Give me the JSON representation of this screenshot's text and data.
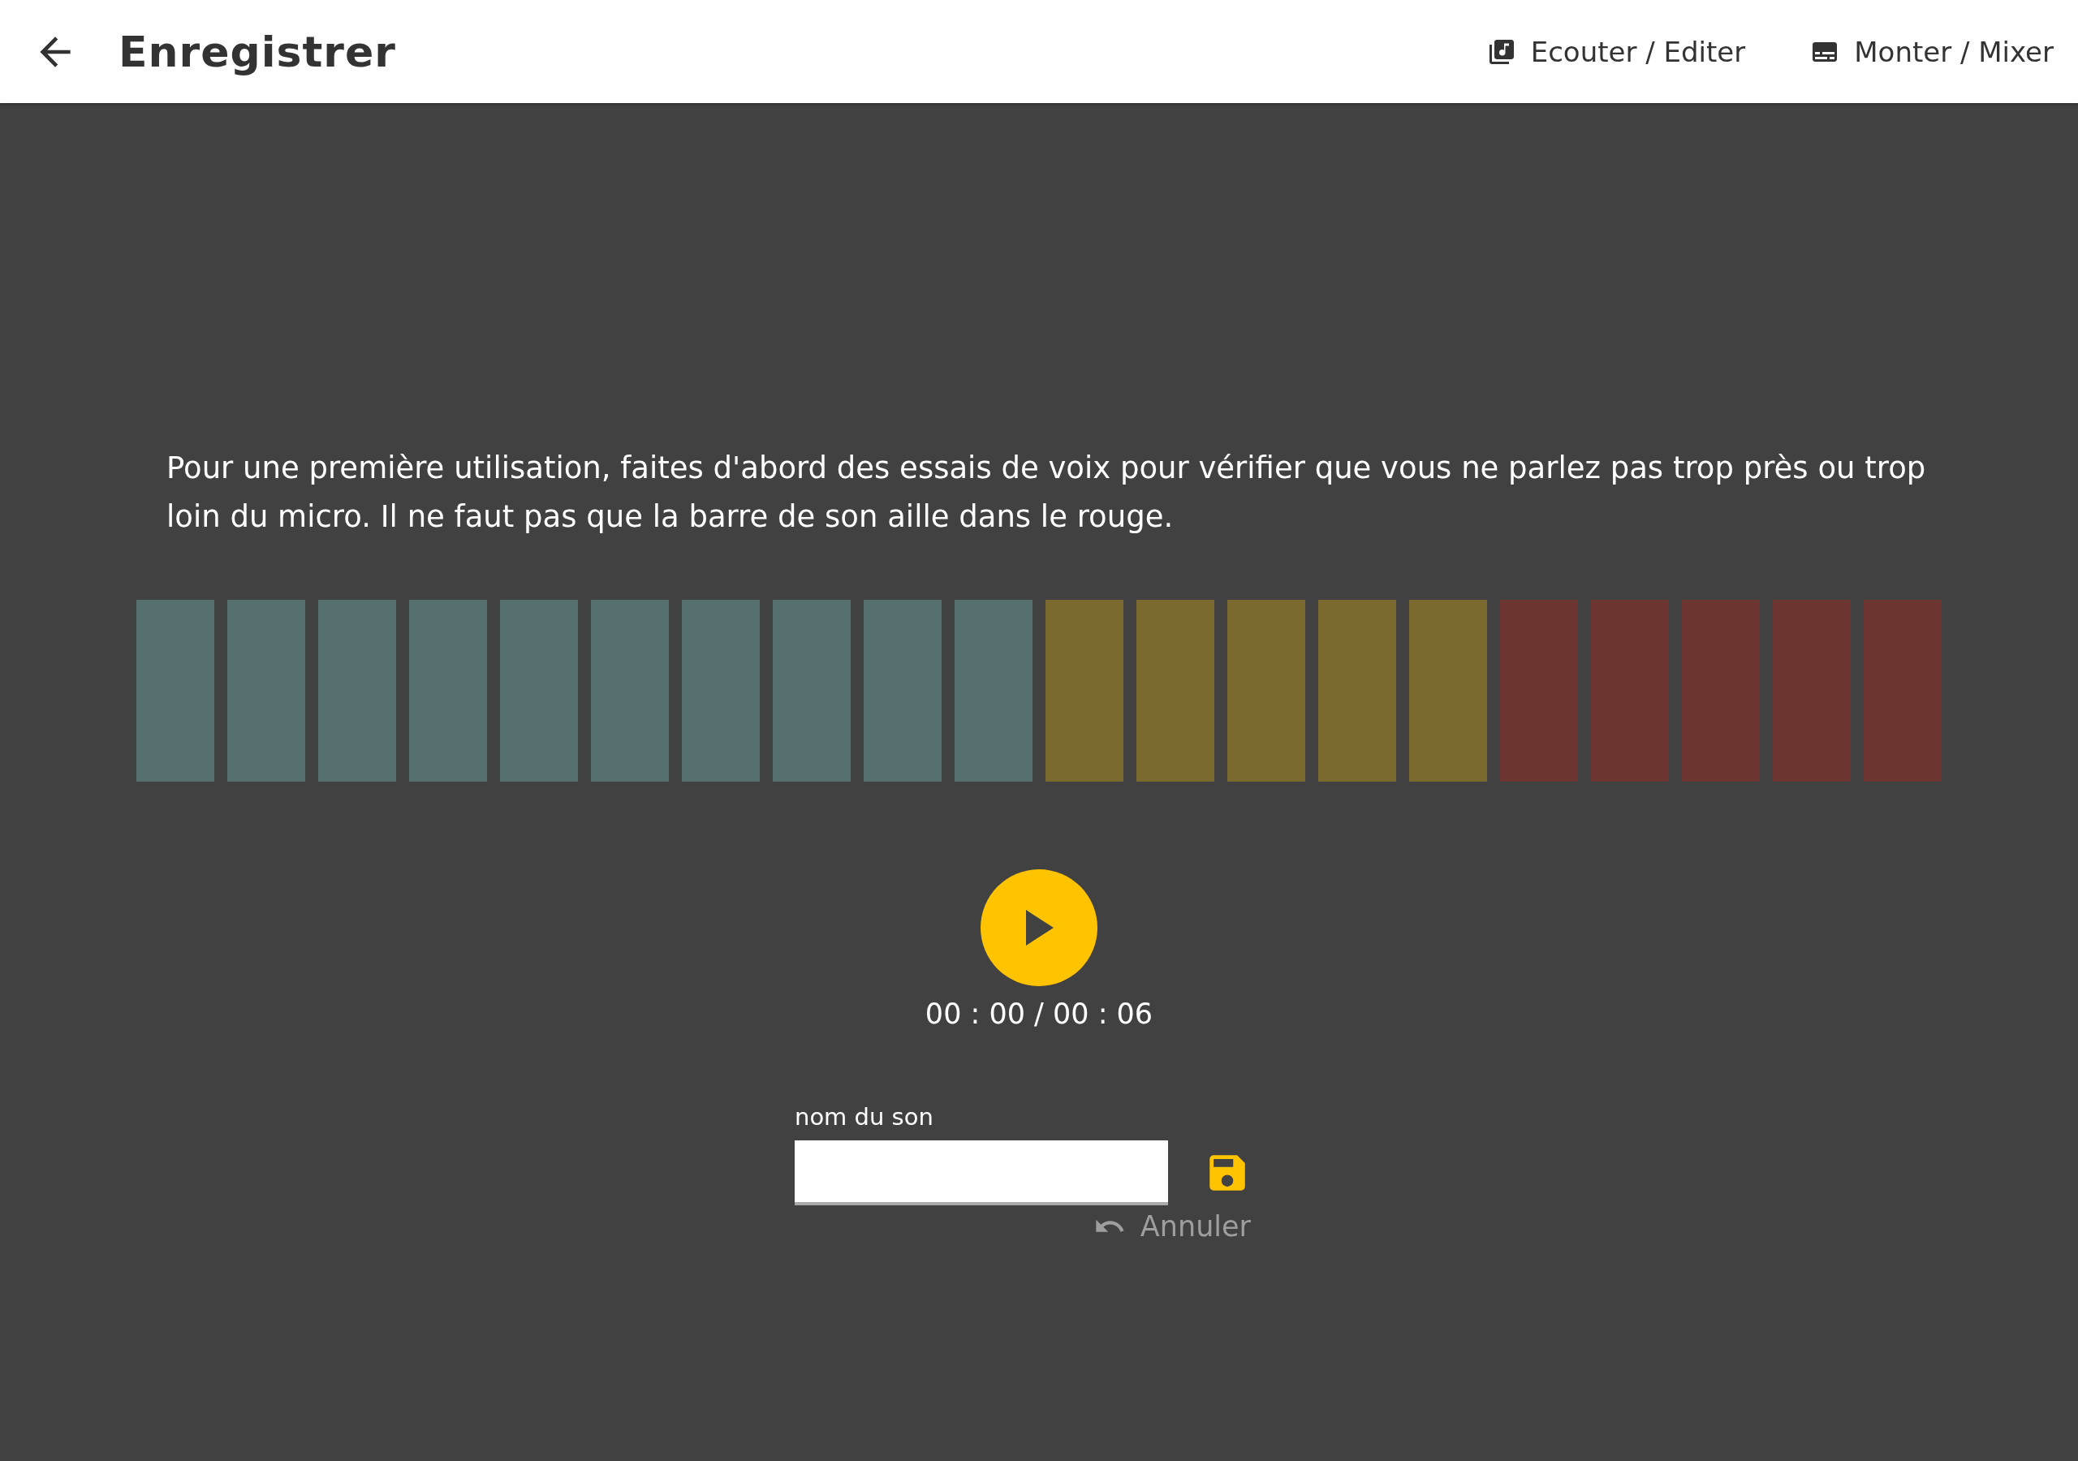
{
  "header": {
    "title": "Enregistrer",
    "nav": [
      {
        "label": "Ecouter / Editer"
      },
      {
        "label": "Monter / Mixer"
      }
    ]
  },
  "instructions": "Pour une première utilisation, faites d'abord des essais de voix pour vérifier que vous ne parlez pas trop près ou trop loin du micro. Il ne faut pas que la barre de son aille dans le rouge.",
  "meter": {
    "segments": [
      {
        "color": "#56706f"
      },
      {
        "color": "#56706f"
      },
      {
        "color": "#56706f"
      },
      {
        "color": "#56706f"
      },
      {
        "color": "#56706f"
      },
      {
        "color": "#56706f"
      },
      {
        "color": "#56706f"
      },
      {
        "color": "#56706f"
      },
      {
        "color": "#56706f"
      },
      {
        "color": "#56706f"
      },
      {
        "color": "#7b6a2f"
      },
      {
        "color": "#7b6a2f"
      },
      {
        "color": "#7b6a2f"
      },
      {
        "color": "#7b6a2f"
      },
      {
        "color": "#7b6a2f"
      },
      {
        "color": "#6c3530"
      },
      {
        "color": "#6c3530"
      },
      {
        "color": "#6c3530"
      },
      {
        "color": "#6c3530"
      },
      {
        "color": "#6c3530"
      }
    ]
  },
  "player": {
    "time": "00 : 00 / 00 : 06"
  },
  "form": {
    "label": "nom du son",
    "cancel": "Annuler"
  }
}
